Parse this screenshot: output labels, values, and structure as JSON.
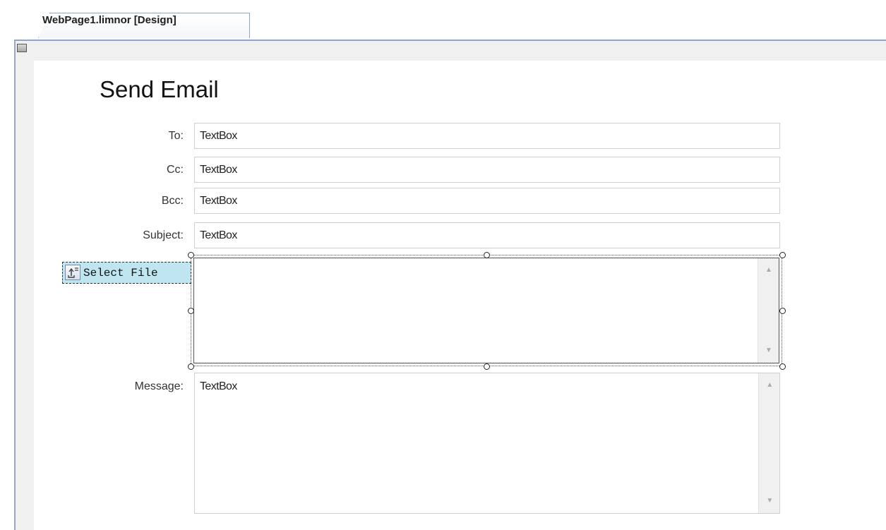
{
  "window": {
    "tab_title": "WebPage1.limnor [Design]"
  },
  "form": {
    "title": "Send Email",
    "fields": [
      {
        "label": "To:",
        "value": "TextBox"
      },
      {
        "label": "Cc:",
        "value": "TextBox"
      },
      {
        "label": "Bcc:",
        "value": "TextBox"
      },
      {
        "label": "Subject:",
        "value": "TextBox"
      }
    ],
    "file_upload": {
      "label": "Select File",
      "icon": "file-upload-icon"
    },
    "message": {
      "label": "Message:",
      "value": "TextBox"
    }
  },
  "colors": {
    "tab_border": "#8fa7c7",
    "selected_control_bg": "#bfe6f0",
    "designer_frame": "#f0f0f0"
  }
}
